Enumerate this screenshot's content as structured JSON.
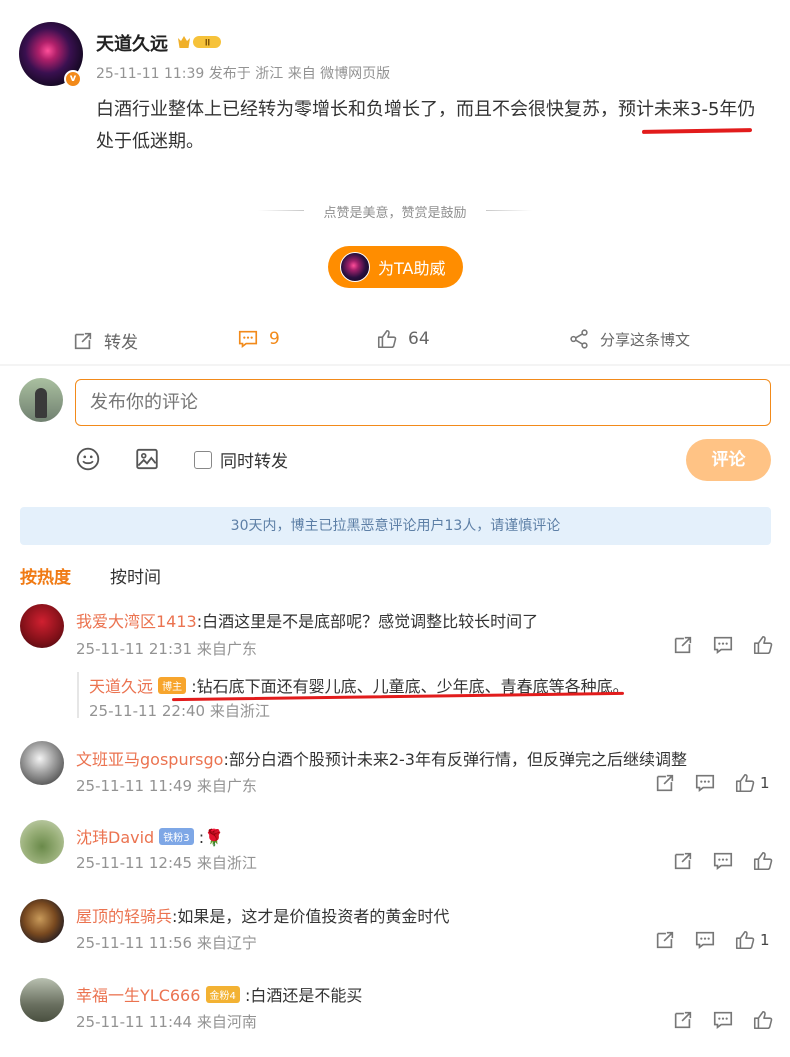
{
  "post": {
    "author": "天道久远",
    "crown_badge": "II",
    "meta": "25-11-11 11:39  发布于 浙江  来自 微博网页版",
    "text": "白酒行业整体上已经转为零增长和负增长了，而且不会很快复苏，预计未来3-5年仍处于低迷期。",
    "verify_mark": "v"
  },
  "reward": {
    "divider_text": "点赞是美意，赞赏是鼓励",
    "cheer_label": "为TA助威"
  },
  "actions": {
    "repost_label": "转发",
    "comment_count": "9",
    "like_count": "64",
    "share_label": "分享这条博文"
  },
  "compose": {
    "placeholder": "发布你的评论",
    "repost_checkbox_label": "同时转发",
    "submit_label": "评论"
  },
  "notice": "30天内，博主已拉黑恶意评论用户13人，请谨慎评论",
  "sort": {
    "hot": "按热度",
    "time": "按时间"
  },
  "comments": [
    {
      "name": "我爱大湾区1413",
      "text": ":白酒这里是不是底部呢？感觉调整比较长时间了",
      "time": "25-11-11 21:31  来自广东",
      "likes": "",
      "reply": {
        "name": "天道久远",
        "badge": "博主",
        "text": ":钻石底下面还有婴儿底、儿童底、少年底、青春底等各种底。",
        "time": "25-11-11 22:40  来自浙江"
      }
    },
    {
      "name": "文班亚马gospursgo",
      "text": ":部分白酒个股预计未来2-3年有反弹行情，但反弹完之后继续调整",
      "time": "25-11-11 11:49  来自广东",
      "likes": "1"
    },
    {
      "name": "沈玮David",
      "badge": "铁粉3",
      "text": ":🌹",
      "time": "25-11-11 12:45  来自浙江",
      "likes": ""
    },
    {
      "name": "屋顶的轻骑兵",
      "text": ":如果是，这才是价值投资者的黄金时代",
      "time": "25-11-11 11:56  来自辽宁",
      "likes": "1"
    },
    {
      "name": "幸福一生YLC666",
      "badge": "金粉4",
      "text": ":白酒还是不能买",
      "time": "25-11-11 11:44  来自河南",
      "likes": ""
    }
  ],
  "colors": {
    "accent": "#f28a1a",
    "name": "#eb7350",
    "notice_bg": "#e4f0fb",
    "annotation": "#e21c1c"
  }
}
